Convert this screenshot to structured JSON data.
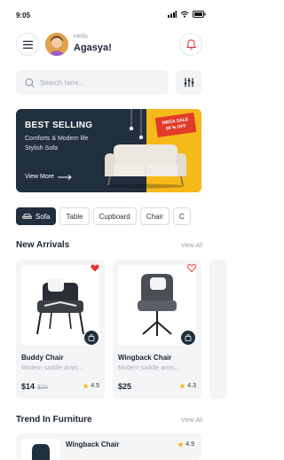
{
  "status": {
    "time": "9:05"
  },
  "header": {
    "greeting": "Hello",
    "user_name": "Agasya!"
  },
  "search": {
    "placeholder": "Search here..."
  },
  "banner": {
    "title": "BEST SELLING",
    "subtitle_line1": "Comforts & Modern life",
    "subtitle_line2": "Stylish Sofa",
    "link_label": "View More",
    "badge_line1": "MEGA SALE",
    "badge_line2": "80 % OFF"
  },
  "categories": [
    {
      "label": "Sofa",
      "active": true
    },
    {
      "label": "Table",
      "active": false
    },
    {
      "label": "Cupboard",
      "active": false
    },
    {
      "label": "Chair",
      "active": false
    },
    {
      "label": "C",
      "active": false
    }
  ],
  "new_arrivals": {
    "title": "New Arrivals",
    "view_all": "View All",
    "products": [
      {
        "name": "Buddy Chair",
        "description": "Modern saddle arms...",
        "price": "$14",
        "old_price": "$20",
        "rating": "4.5",
        "favorited": true
      },
      {
        "name": "Wingback Chair",
        "description": "Modern saddle arms...",
        "price": "$25",
        "old_price": "",
        "rating": "4.3",
        "favorited": false
      }
    ]
  },
  "trend": {
    "title": "Trend In Furniture",
    "view_all": "View All",
    "items": [
      {
        "name": "Wingback Chair",
        "rating": "4.9"
      }
    ]
  },
  "colors": {
    "primary": "#1f2f3d",
    "accent": "#f6b91a",
    "badge": "#e23b2b",
    "heart": "#e53935"
  }
}
